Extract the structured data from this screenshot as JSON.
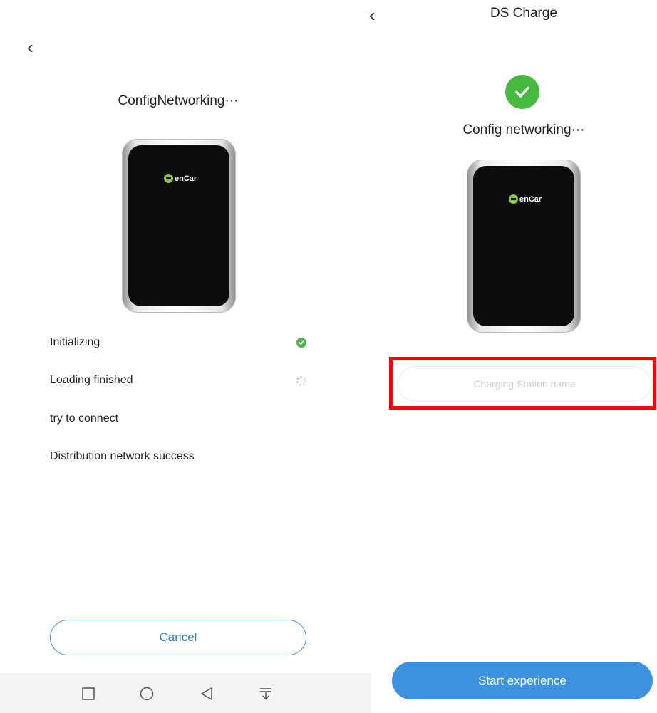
{
  "left": {
    "title": "ConfigNetworking···",
    "device_logo": "enCar",
    "steps": [
      {
        "label": "Initializing",
        "status": "done"
      },
      {
        "label": "Loading finished",
        "status": "loading"
      },
      {
        "label": "try to connect",
        "status": "pending"
      },
      {
        "label": "Distribution network success",
        "status": "pending"
      }
    ],
    "cancel_label": "Cancel",
    "nav_icons": [
      "square-recent-icon",
      "circle-home-icon",
      "triangle-back-icon",
      "notification-pulldown-icon"
    ]
  },
  "right": {
    "header_title": "DS Charge",
    "subtitle": "Config networking···",
    "device_logo": "enCar",
    "station_name_placeholder": "Charging Station name",
    "start_label": "Start experience"
  },
  "colors": {
    "accent_blue": "#3d92e0",
    "success_green": "#46b93f",
    "highlight_red": "#ff0000",
    "brand_green": "#8cc63f"
  }
}
